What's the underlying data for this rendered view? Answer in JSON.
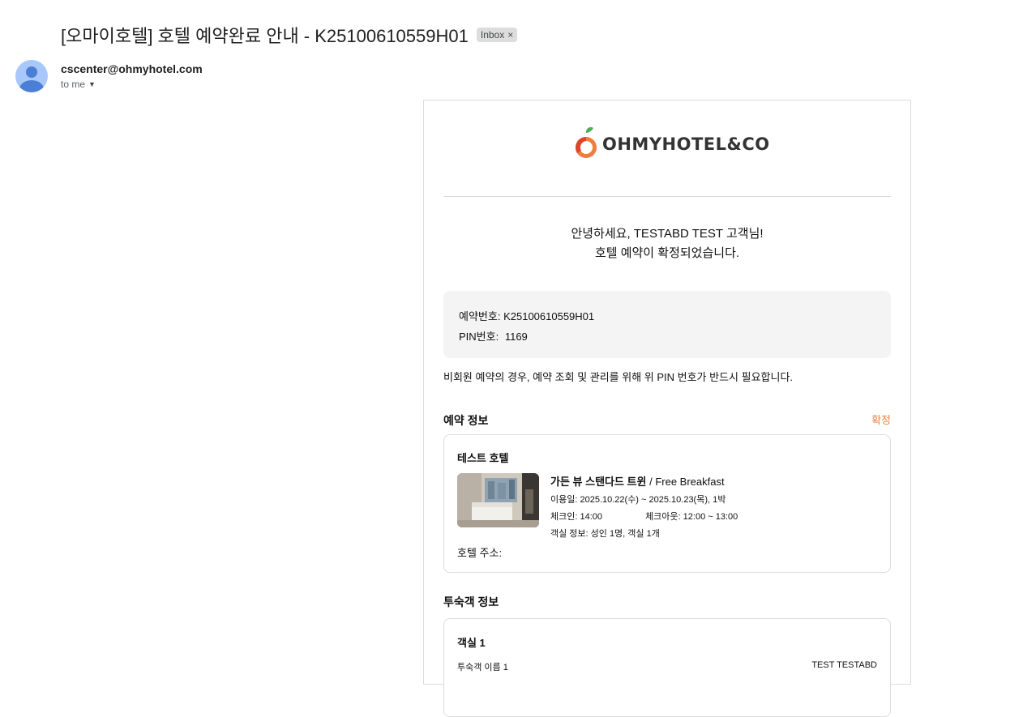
{
  "email": {
    "subject": "[오마이호텔] 호텔 예약완료 안내 - K25100610559H01",
    "label": "Inbox",
    "label_close": "×",
    "sender": "cscenter@ohmyhotel.com",
    "to": "to me"
  },
  "body": {
    "logo_text": "OHMYHOTEL&CO",
    "greeting_line1": "안녕하세요, TESTABD TEST 고객님!",
    "greeting_line2": "호텔 예약이 확정되었습니다.",
    "reservation_no_label": "예약번호:",
    "reservation_no": "K25100610559H01",
    "pin_label": "PIN번호:",
    "pin": "1169",
    "pin_note": "비회원 예약의 경우, 예약 조회 및 관리를 위해 위 PIN 번호가 반드시 필요합니다.",
    "reservation_section_title": "예약 정보",
    "status": "확정",
    "hotel": {
      "name": "테스트 호텔",
      "room_name": "가든 뷰 스탠다드 트윈",
      "room_plan": " / Free Breakfast",
      "stay_dates": "이용일: 2025.10.22(수) ~ 2025.10.23(목), 1박",
      "checkin": "체크인: 14:00",
      "checkout": "체크아웃: 12:00 ~ 13:00",
      "room_guests": "객실 정보: 성인 1명, 객실 1개",
      "address_label": "호텔 주소:"
    },
    "guest_section_title": "투숙객 정보",
    "guest": {
      "room_label": "객실 1",
      "name_label": "투숙객 이름 1",
      "name_value": "TEST TESTABD"
    }
  },
  "colors": {
    "accent": "#f07d3c",
    "avatar_bg": "#a8c7fa",
    "avatar_fg": "#4b7fd6"
  }
}
